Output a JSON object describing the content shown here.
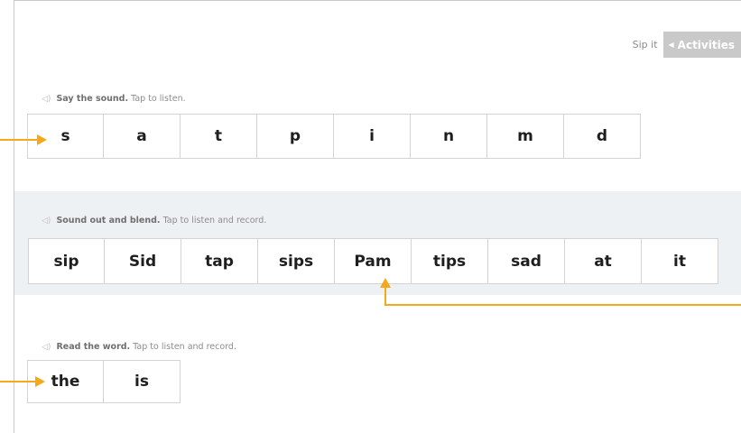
{
  "header": {
    "title": "Sip it",
    "activities_label": "Activities",
    "activities_icon": "back-triangle-icon"
  },
  "sections": {
    "sounds": {
      "heading": "Say the sound.",
      "instruction": "Tap to listen.",
      "tiles": [
        "s",
        "a",
        "t",
        "p",
        "i",
        "n",
        "m",
        "d"
      ]
    },
    "blend": {
      "heading": "Sound out and blend.",
      "instruction": "Tap to listen and record.",
      "tiles": [
        "sip",
        "Sid",
        "tap",
        "sips",
        "Pam",
        "tips",
        "sad",
        "at",
        "it"
      ]
    },
    "read": {
      "heading": "Read the word.",
      "instruction": "Tap to listen and record.",
      "tiles": [
        "the",
        "is"
      ]
    }
  },
  "colors": {
    "accent_arrow": "#f4a81c",
    "band": "#eef1f4",
    "tile_border": "#d3d3d3",
    "button_bg": "#c9c9c9"
  }
}
